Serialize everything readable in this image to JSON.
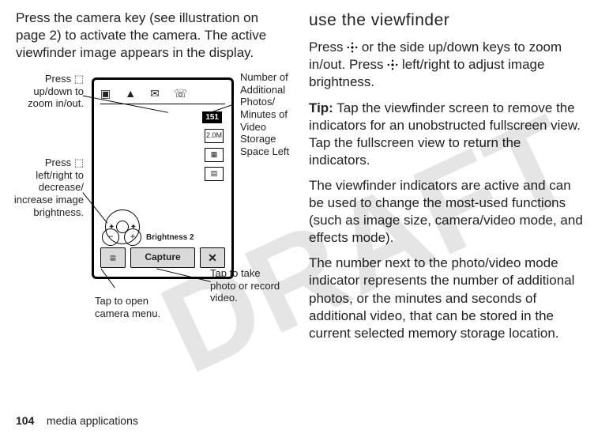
{
  "watermark": "DRAFT",
  "left": {
    "intro": "Press the camera key (see illustration on page 2) to activate the camera. The active viewfinder image appears in the display."
  },
  "right": {
    "heading": "use the viewfinder",
    "para1a": "Press ",
    "para1b": " or the side up/down keys to zoom in/out. Press ",
    "para1c": " left/right to adjust image brightness.",
    "tip_label": "Tip:",
    "tip_body": " Tap the viewfinder screen to remove the indicators for an unobstructed fullscreen view. Tap the fullscreen view to return the indicators.",
    "para3": "The viewfinder indicators are active and can be used to change the most-used functions (such as image size, camera/video mode, and effects mode).",
    "para4": "The number next to the photo/video mode indicator represents the number of additional photos, or the minutes and seconds of additional video, that can be stored in the current selected memory storage location."
  },
  "phone": {
    "counter": "151",
    "capture_label": "Capture",
    "brightness_label": "Brightness 2",
    "size_icon_label": "2.0M"
  },
  "callouts": {
    "zoom": "Press ⬚ up/down to zoom in/out.",
    "brightness": "Press ⬚ left/right to decrease/ increase image brightness.",
    "additional": "Number of Additional Photos/ Minutes of Video Storage Space Left",
    "menu": "Tap to open camera menu.",
    "take": "Tap to take photo or record video."
  },
  "footer": {
    "page_number": "104",
    "section": "media applications"
  }
}
